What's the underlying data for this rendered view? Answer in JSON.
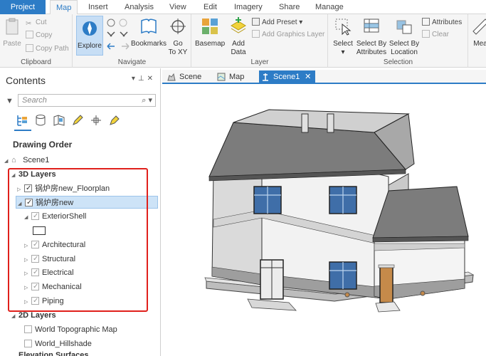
{
  "tabs": [
    {
      "label": "Project"
    },
    {
      "label": "Map"
    },
    {
      "label": "Insert"
    },
    {
      "label": "Analysis"
    },
    {
      "label": "View"
    },
    {
      "label": "Edit"
    },
    {
      "label": "Imagery"
    },
    {
      "label": "Share"
    },
    {
      "label": "Manage"
    }
  ],
  "ribbon": {
    "clipboard": {
      "paste": "Paste",
      "cut": "Cut",
      "copy": "Copy",
      "copy_path": "Copy Path",
      "group": "Clipboard"
    },
    "navigate": {
      "explore": "Explore",
      "bookmarks": "Bookmarks",
      "goto": "Go\nTo XY",
      "goto_1": "Go",
      "goto_2": "To XY",
      "group": "Navigate"
    },
    "layer": {
      "basemap": "Basemap",
      "add_data": "Add\nData",
      "add_data_1": "Add",
      "add_data_2": "Data",
      "add_preset": "Add Preset",
      "add_graphics": "Add Graphics Layer",
      "group": "Layer"
    },
    "selection": {
      "select": "Select",
      "select_by_attr_1": "Select By",
      "select_by_attr_2": "Attributes",
      "select_by_loc_1": "Select By",
      "select_by_loc_2": "Location",
      "attributes": "Attributes",
      "clear": "Clear",
      "group": "Selection"
    },
    "overflow": "Mea"
  },
  "contents": {
    "title": "Contents",
    "search_placeholder": "Search",
    "drawing_order": "Drawing Order",
    "scene_name": "Scene1",
    "group_3d": "3D Layers",
    "layer_floorplan": "锅炉房new_Floorplan",
    "layer_main": "锅炉房new",
    "exterior_shell": "ExteriorShell",
    "architectural": "Architectural",
    "structural": "Structural",
    "electrical": "Electrical",
    "mechanical": "Mechanical",
    "piping": "Piping",
    "group_2d": "2D Layers",
    "world_topo": "World Topographic Map",
    "world_hillshade": "World_Hillshade",
    "elevation_partial": "Elevation Surfaces"
  },
  "view_tabs": [
    {
      "label": "Scene"
    },
    {
      "label": "Map"
    },
    {
      "label": "Scene1"
    }
  ],
  "colors": {
    "accent": "#2d7cc6",
    "highlight": "#e0201b"
  }
}
